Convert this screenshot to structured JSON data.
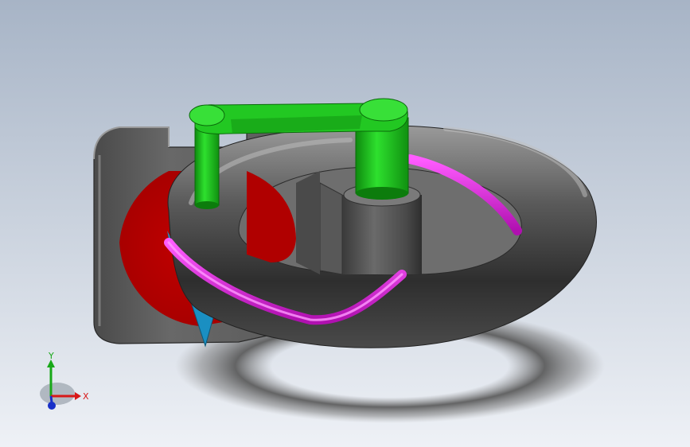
{
  "viewport": {
    "background_top": "#a9b6c8",
    "background_bottom": "#eef1f6"
  },
  "model": {
    "colors": {
      "body": "#5e5e5e",
      "body_dark": "#3a3a3a",
      "body_light": "#8a8a8a",
      "torus": "#6a6a6a",
      "disc": "#b80000",
      "lever": "#1fc21f",
      "lever_dark": "#0f8f0f",
      "path": "#e020e0",
      "fin": "#1a90c0"
    }
  },
  "triad": {
    "x_label": "X",
    "y_label": "Y",
    "x_color": "#d81818",
    "y_color": "#18a818",
    "z_color": "#1830c8"
  }
}
